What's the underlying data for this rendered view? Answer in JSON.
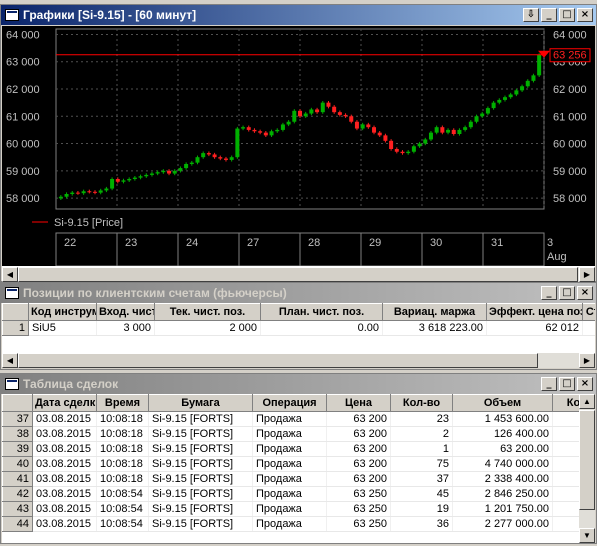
{
  "chart_window": {
    "title": "Графики [Si-9.15] - [60 минут]",
    "y_ticks": [
      "64 000",
      "63 000",
      "62 000",
      "61 000",
      "60 000",
      "59 000",
      "58 000"
    ],
    "price_label": "63 256",
    "legend": "Si-9.15 [Price]",
    "date_labels": [
      "22",
      "23",
      "24",
      "27",
      "28",
      "29",
      "30",
      "31",
      "3"
    ],
    "date_sublabel": "Aug",
    "colors": {
      "up": "#00b000",
      "down": "#ff2020",
      "level": "#ff0000",
      "grid": "#505050"
    }
  },
  "chart_data": {
    "type": "candlestick",
    "y_range": [
      57600,
      64200
    ],
    "level": 63256,
    "x_labels": [
      "22",
      "23",
      "24",
      "27",
      "28",
      "29",
      "30",
      "31",
      "3 Aug"
    ],
    "closes": [
      58050,
      58150,
      58200,
      58180,
      58250,
      58230,
      58200,
      58280,
      58350,
      58700,
      58600,
      58650,
      58700,
      58750,
      58800,
      58850,
      58900,
      58950,
      59000,
      58900,
      59000,
      59100,
      59250,
      59300,
      59500,
      59650,
      59600,
      59500,
      59450,
      59400,
      59500,
      60550,
      60600,
      60500,
      60450,
      60400,
      60300,
      60450,
      60500,
      60700,
      60800,
      61200,
      61000,
      61100,
      61250,
      61150,
      61500,
      61350,
      61150,
      61050,
      61000,
      60800,
      60550,
      60700,
      60600,
      60400,
      60300,
      60100,
      59800,
      59700,
      59650,
      59700,
      59900,
      60000,
      60150,
      60400,
      60600,
      60400,
      60500,
      60350,
      60500,
      60600,
      60800,
      61000,
      61100,
      61300,
      61500,
      61600,
      61700,
      61800,
      61950,
      62100,
      62300,
      62500,
      63250
    ]
  },
  "positions_window": {
    "title": "Позиции по клиентским счетам (фьючерсы)",
    "columns": [
      "Код инструмента",
      "Вход. чистые",
      "Тек. чист. поз.",
      "План. чист. поз.",
      "Вариац. маржа",
      "Эффект. цена поз.",
      "Ст"
    ],
    "rows": [
      {
        "n": "1",
        "code": "SiU5",
        "in": "3 000",
        "cur": "2 000",
        "plan": "0.00",
        "margin": "3 618 223.00",
        "eff": "62 012"
      }
    ]
  },
  "trades_window": {
    "title": "Таблица сделок",
    "columns": [
      "Дата сделки",
      "Время",
      "Бумага",
      "Операция",
      "Цена",
      "Кол-во",
      "Объем",
      "Ком"
    ],
    "rows": [
      {
        "n": "37",
        "date": "03.08.2015",
        "time": "10:08:18",
        "sec": "Si-9.15 [FORTS]",
        "op": "Продажа",
        "price": "63 200",
        "qty": "23",
        "vol": "1 453 600.00"
      },
      {
        "n": "38",
        "date": "03.08.2015",
        "time": "10:08:18",
        "sec": "Si-9.15 [FORTS]",
        "op": "Продажа",
        "price": "63 200",
        "qty": "2",
        "vol": "126 400.00"
      },
      {
        "n": "39",
        "date": "03.08.2015",
        "time": "10:08:18",
        "sec": "Si-9.15 [FORTS]",
        "op": "Продажа",
        "price": "63 200",
        "qty": "1",
        "vol": "63 200.00"
      },
      {
        "n": "40",
        "date": "03.08.2015",
        "time": "10:08:18",
        "sec": "Si-9.15 [FORTS]",
        "op": "Продажа",
        "price": "63 200",
        "qty": "75",
        "vol": "4 740 000.00"
      },
      {
        "n": "41",
        "date": "03.08.2015",
        "time": "10:08:18",
        "sec": "Si-9.15 [FORTS]",
        "op": "Продажа",
        "price": "63 200",
        "qty": "37",
        "vol": "2 338 400.00"
      },
      {
        "n": "42",
        "date": "03.08.2015",
        "time": "10:08:54",
        "sec": "Si-9.15 [FORTS]",
        "op": "Продажа",
        "price": "63 250",
        "qty": "45",
        "vol": "2 846 250.00"
      },
      {
        "n": "43",
        "date": "03.08.2015",
        "time": "10:08:54",
        "sec": "Si-9.15 [FORTS]",
        "op": "Продажа",
        "price": "63 250",
        "qty": "19",
        "vol": "1 201 750.00"
      },
      {
        "n": "44",
        "date": "03.08.2015",
        "time": "10:08:54",
        "sec": "Si-9.15 [FORTS]",
        "op": "Продажа",
        "price": "63 250",
        "qty": "36",
        "vol": "2 277 000.00"
      }
    ]
  },
  "icons": {
    "minimize": "minimize-icon",
    "maximize": "maximize-icon",
    "close": "close-icon",
    "pin": "pin-icon"
  }
}
